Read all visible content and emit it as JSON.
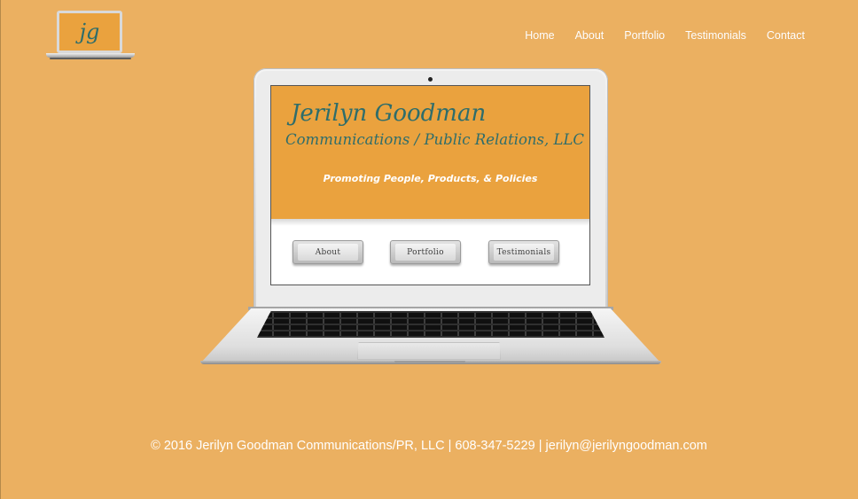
{
  "header": {
    "logo_text": "jg",
    "nav": [
      "Home",
      "About",
      "Portfolio",
      "Testimonials",
      "Contact"
    ]
  },
  "preview": {
    "title": "Jerilyn Goodman",
    "subtitle": "Communications / Public Relations, LLC",
    "tagline": "Promoting People, Products, & Policies",
    "buttons": [
      "About",
      "Portfolio",
      "Testimonials"
    ]
  },
  "footer": {
    "copyright": "© 2016 Jerilyn Goodman Communications/PR, LLC",
    "separator": " | ",
    "phone": "608-347-5229",
    "email": "jerilyn@jerilyngoodman.com"
  },
  "colors": {
    "background": "#ebb061",
    "hero": "#eaa23e",
    "brand_text": "#2e6d6b",
    "nav_text": "#ffffff"
  }
}
